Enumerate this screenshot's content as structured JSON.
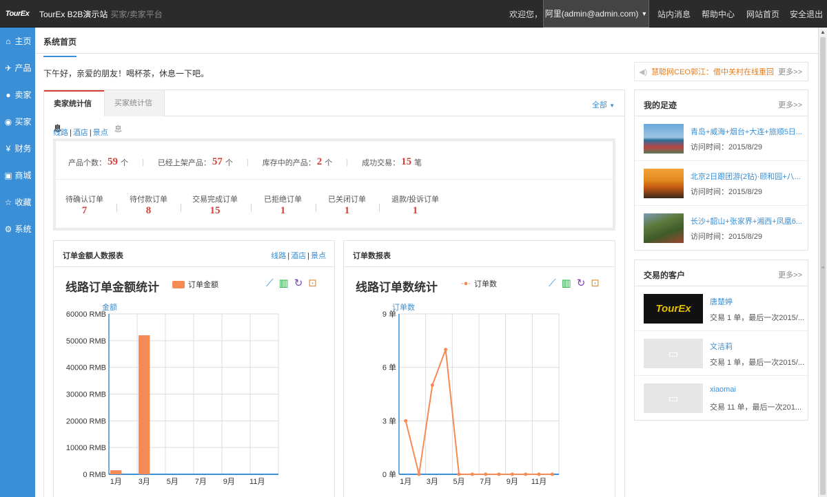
{
  "topbar": {
    "logo": "TourEx",
    "site_name": "TourEx B2B演示站",
    "site_sub": "买家/卖家平台",
    "welcome": "欢迎您，",
    "user": "阿里(admin@admin.com)",
    "links": [
      "站内消息",
      "帮助中心",
      "网站首页",
      "安全退出"
    ]
  },
  "sidebar": {
    "items": [
      {
        "label": "主页",
        "icon": "home-icon",
        "glyph": "⌂"
      },
      {
        "label": "产品",
        "icon": "plane-icon",
        "glyph": "✈"
      },
      {
        "label": "卖家",
        "icon": "user-icon",
        "glyph": "●"
      },
      {
        "label": "买家",
        "icon": "users-icon",
        "glyph": "◉"
      },
      {
        "label": "财务",
        "icon": "yen-icon",
        "glyph": "¥"
      },
      {
        "label": "商城",
        "icon": "box-icon",
        "glyph": "▣"
      },
      {
        "label": "收藏",
        "icon": "star-icon",
        "glyph": "☆"
      },
      {
        "label": "系统",
        "icon": "gear-icon",
        "glyph": "⚙"
      }
    ]
  },
  "page": {
    "title": "系统首页",
    "greeting": "下午好，亲爱的朋友！喝杯茶，休息一下吧。"
  },
  "notice": {
    "text": "慧聪网CEO郭江：借中关村在线重回...",
    "more": "更多>>"
  },
  "tabs": {
    "active": "卖家统计信息",
    "inactive": "买家统计信息",
    "filter": "全部"
  },
  "category_links": [
    "线路",
    "酒店",
    "景点"
  ],
  "stats_row1": [
    {
      "label": "产品个数：",
      "value": "59",
      "unit": "个"
    },
    {
      "label": "已经上架产品：",
      "value": "57",
      "unit": "个"
    },
    {
      "label": "库存中的产品：",
      "value": "2",
      "unit": "个"
    },
    {
      "label": "成功交易：",
      "value": "15",
      "unit": "笔"
    }
  ],
  "stats_row2": [
    {
      "label": "待确认订单",
      "value": "7"
    },
    {
      "label": "待付款订单",
      "value": "8"
    },
    {
      "label": "交易完成订单",
      "value": "15"
    },
    {
      "label": "已拒绝订单",
      "value": "1"
    },
    {
      "label": "已关闭订单",
      "value": "1"
    },
    {
      "label": "退款/投诉订单",
      "value": "1"
    }
  ],
  "amount_panel": {
    "header": "订单金额人数报表",
    "links": [
      "线路",
      "酒店",
      "景点"
    ]
  },
  "count_panel": {
    "header": "订单数报表"
  },
  "chart_data": [
    {
      "type": "bar",
      "title": "线路订单金额统计",
      "ylabel": "金额",
      "legend": "订单金额",
      "legend_color": "#f58a55",
      "x_ticks": [
        "1月",
        "3月",
        "5月",
        "7月",
        "9月",
        "11月"
      ],
      "y_ticks": [
        "60000 RMB",
        "50000 RMB",
        "40000 RMB",
        "30000 RMB",
        "20000 RMB",
        "10000 RMB",
        "0 RMB"
      ],
      "ylim": [
        0,
        60000
      ],
      "categories": [
        "1月",
        "2月",
        "3月",
        "4月",
        "5月",
        "6月",
        "7月",
        "8月",
        "9月",
        "10月",
        "11月",
        "12月"
      ],
      "values": [
        1500,
        0,
        52000,
        0,
        0,
        0,
        0,
        0,
        0,
        0,
        0,
        0
      ],
      "grid": true
    },
    {
      "type": "line",
      "title": "线路订单数统计",
      "ylabel": "订单数",
      "legend": "订单数",
      "legend_color": "#f58a55",
      "x_ticks": [
        "1月",
        "3月",
        "5月",
        "7月",
        "9月",
        "11月"
      ],
      "y_ticks": [
        "9 单",
        "6 单",
        "3 单",
        "0 单"
      ],
      "ylim": [
        0,
        9
      ],
      "x": [
        "1月",
        "2月",
        "3月",
        "4月",
        "5月",
        "6月",
        "7月",
        "8月",
        "9月",
        "10月",
        "11月",
        "12月"
      ],
      "values": [
        3,
        0,
        5,
        7,
        0,
        0,
        0,
        0,
        0,
        0,
        0,
        0
      ],
      "grid": true
    }
  ],
  "footprints": {
    "title": "我的足迹",
    "more": "更多>>",
    "items": [
      {
        "name": "青岛+威海+烟台+大连+旅顺5日...",
        "sub": "访问时间：2015/8/29"
      },
      {
        "name": "北京2日跟团游(2钻)·颐和园+八...",
        "sub": "访问时间：2015/8/29"
      },
      {
        "name": "长沙+韶山+张家界+湘西+凤凰6...",
        "sub": "访问时间：2015/8/29"
      }
    ]
  },
  "customers": {
    "title": "交易的客户",
    "more": "更多>>",
    "items": [
      {
        "name": "唐楚婷",
        "sub": "交易 1 单，最后一次2015/...",
        "logo": "TourEx"
      },
      {
        "name": "文洁莉",
        "sub": "交易 1 单，最后一次2015/...",
        "logo": ""
      },
      {
        "name": "xiaomai",
        "sub": "交易 11 单，最后一次201...",
        "logo": ""
      }
    ]
  }
}
